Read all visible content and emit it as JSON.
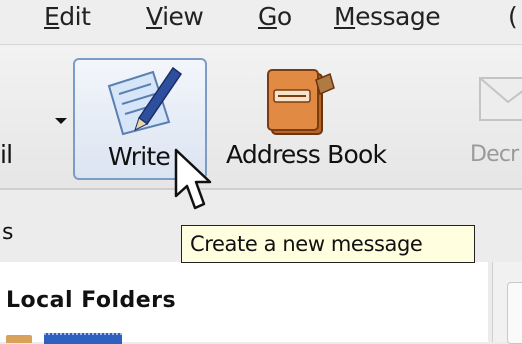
{
  "menubar": {
    "items": [
      {
        "label": "Edit",
        "accel": "E",
        "rest": "dit"
      },
      {
        "label": "View",
        "accel": "V",
        "rest": "iew"
      },
      {
        "label": "Go",
        "accel": "G",
        "rest": "o"
      },
      {
        "label": "Message",
        "accel": "M",
        "rest": "essage"
      },
      {
        "label": "("
      }
    ]
  },
  "toolbar": {
    "get_mail_partial": "il",
    "write_label": "Write",
    "address_book_label": "Address Book",
    "decrypt_partial": "Decr"
  },
  "tooltip": {
    "text": "Create a new message"
  },
  "folder_pane": {
    "header_partial": "s",
    "root_label": "Local Folders"
  }
}
